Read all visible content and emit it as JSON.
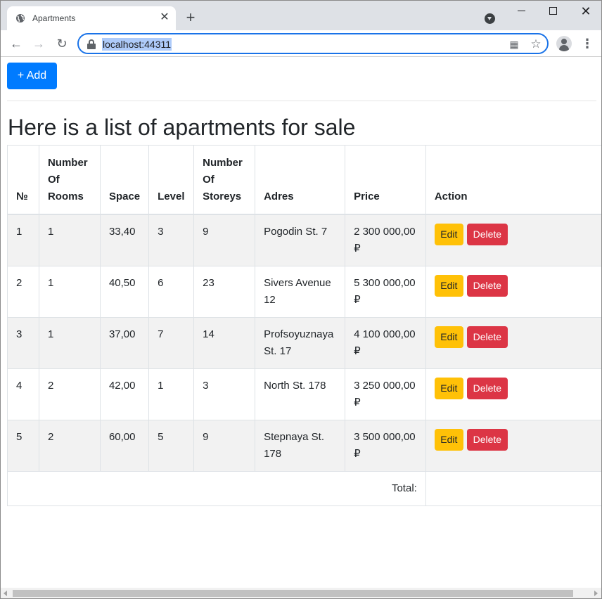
{
  "browser": {
    "tab_title": "Apartments",
    "url": "localhost:44311",
    "new_tab_symbol": "+",
    "close_symbol": "✕"
  },
  "page": {
    "add_button": "+ Add",
    "heading": "Here is a list of apartments for sale",
    "table": {
      "headers": [
        "№",
        "Number Of Rooms",
        "Space",
        "Level",
        "Number Of Storeys",
        "Adres",
        "Price",
        "Action"
      ],
      "rows": [
        {
          "id": "1",
          "rooms": "1",
          "space": "33,40",
          "level": "3",
          "storeys": "9",
          "adres": "Pogodin St. 7",
          "price": "2 300 000,00 ₽"
        },
        {
          "id": "2",
          "rooms": "1",
          "space": "40,50",
          "level": "6",
          "storeys": "23",
          "adres": "Sivers Avenue 12",
          "price": "5 300 000,00 ₽"
        },
        {
          "id": "3",
          "rooms": "1",
          "space": "37,00",
          "level": "7",
          "storeys": "14",
          "adres": "Profsoyuznaya St. 17",
          "price": "4 100 000,00 ₽"
        },
        {
          "id": "4",
          "rooms": "2",
          "space": "42,00",
          "level": "1",
          "storeys": "3",
          "adres": "North St. 178",
          "price": "3 250 000,00 ₽"
        },
        {
          "id": "5",
          "rooms": "2",
          "space": "60,00",
          "level": "5",
          "storeys": "9",
          "adres": "Stepnaya St. 178",
          "price": "3 500 000,00 ₽"
        }
      ],
      "edit_label": "Edit",
      "delete_label": "Delete",
      "total_label": "Total:"
    }
  },
  "colors": {
    "primary": "#007bff",
    "warning": "#ffc107",
    "danger": "#dc3545",
    "stripe": "#f2f2f2"
  }
}
